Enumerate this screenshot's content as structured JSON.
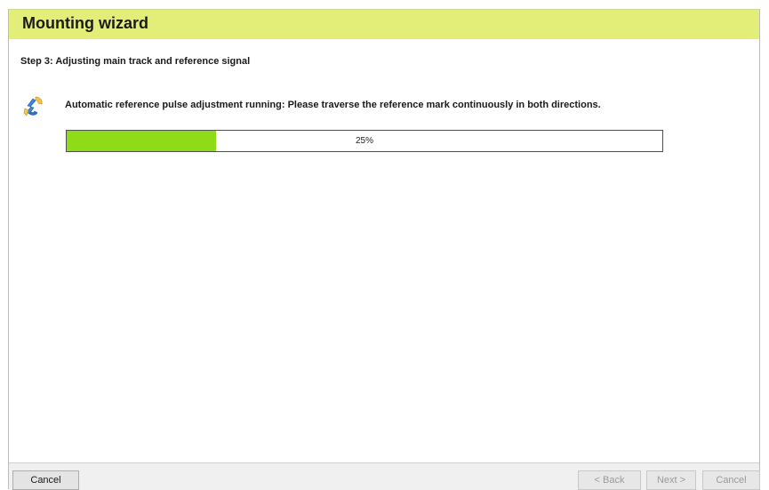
{
  "header": {
    "title": "Mounting wizard"
  },
  "step": {
    "label": "Step 3: Adjusting main track and reference signal"
  },
  "status": {
    "icon": "adjustment-process-icon",
    "message": "Automatic reference pulse adjustment running: Please traverse the reference mark continuously in both directions."
  },
  "progress": {
    "value": 0.25,
    "label": "25%",
    "fill_color": "#8edc18"
  },
  "footer": {
    "cancel_left_label": "Cancel",
    "back_label": "< Back",
    "next_label": "Next >",
    "cancel_right_label": "Cancel"
  },
  "colors": {
    "header_background": "#e3ee79"
  }
}
